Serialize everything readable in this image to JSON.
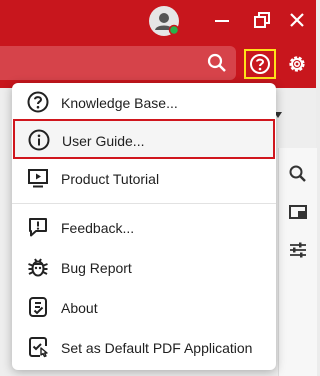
{
  "colors": {
    "titlebar": "#c8161d",
    "highlight": "#d0161d",
    "help_outline": "#ffe21a",
    "presence": "#28b34b"
  },
  "titlebar_icons": [
    "user-avatar-icon",
    "minimize-icon",
    "restore-icon",
    "close-icon",
    "search-icon",
    "help-icon",
    "gear-icon"
  ],
  "help_menu": {
    "items": [
      {
        "label": "Knowledge Base...",
        "icon": "help-circle-icon"
      },
      {
        "label": "User Guide...",
        "icon": "info-circle-icon",
        "selected": true
      },
      {
        "label": "Product Tutorial",
        "icon": "video-tutorial-icon"
      },
      {
        "label": "Feedback...",
        "icon": "feedback-icon"
      },
      {
        "label": "Bug Report",
        "icon": "bug-icon"
      },
      {
        "label": "About",
        "icon": "about-icon"
      },
      {
        "label": "Set as Default PDF Application",
        "icon": "default-app-icon"
      }
    ]
  },
  "right_panel_icons": [
    "search-icon",
    "panel-icon",
    "sliders-icon"
  ]
}
